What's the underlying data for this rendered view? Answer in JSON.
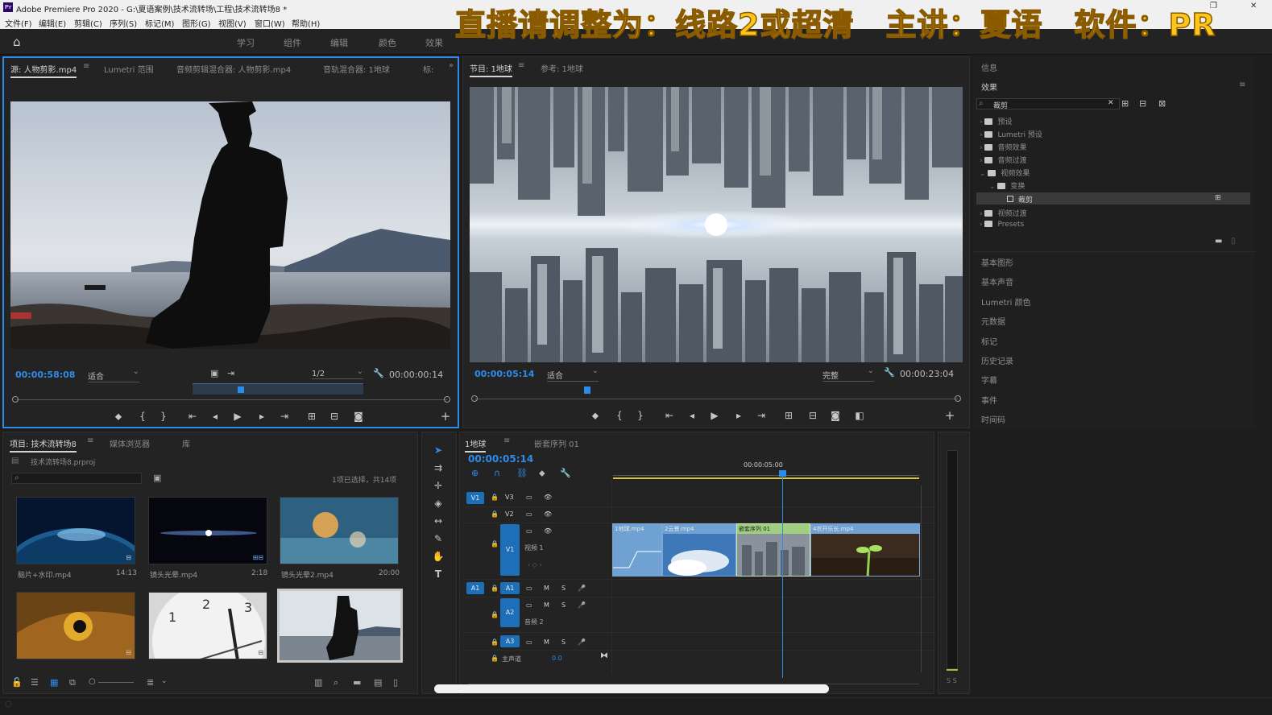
{
  "window": {
    "title": "Adobe Premiere Pro 2020 - G:\\夏语案例\\技术流转场\\工程\\技术流转场8 *",
    "app_icon": "Pr"
  },
  "menu": [
    "文件(F)",
    "编辑(E)",
    "剪辑(C)",
    "序列(S)",
    "标记(M)",
    "图形(G)",
    "视图(V)",
    "窗口(W)",
    "帮助(H)"
  ],
  "banner": "直播请调整为：线路2或超清　主讲：夏语　软件：PR",
  "workspaces": [
    "学习",
    "组件",
    "编辑",
    "颜色",
    "效果"
  ],
  "source_monitor": {
    "tabs": [
      "源: 人物剪影.mp4",
      "Lumetri 范围",
      "音频剪辑混合器: 人物剪影.mp4",
      "音轨混合器: 1地球",
      "标:"
    ],
    "timecode_left": "00:00:58:08",
    "fit": "适合",
    "resolution": "1/2",
    "timecode_right": "00:00:00:14"
  },
  "program_monitor": {
    "tabs": [
      "节目: 1地球",
      "参考: 1地球"
    ],
    "timecode_left": "00:00:05:14",
    "fit": "适合",
    "quality": "完整",
    "timecode_right": "00:00:23:04"
  },
  "effects_panel": {
    "info_tab": "信息",
    "title": "效果",
    "search_value": "裁剪",
    "tree": [
      {
        "label": "预设",
        "depth": 0
      },
      {
        "label": "Lumetri 预设",
        "depth": 0
      },
      {
        "label": "音频效果",
        "depth": 0
      },
      {
        "label": "音频过渡",
        "depth": 0
      },
      {
        "label": "视频效果",
        "depth": 0
      },
      {
        "label": "变换",
        "depth": 1
      },
      {
        "label": "裁剪",
        "depth": 2
      },
      {
        "label": "视频过渡",
        "depth": 0
      },
      {
        "label": "Presets",
        "depth": 0
      }
    ],
    "other_panels": [
      "基本图形",
      "基本声音",
      "Lumetri 颜色",
      "元数据",
      "标记",
      "历史记录",
      "字幕",
      "事件",
      "时间码"
    ]
  },
  "project_panel": {
    "tabs": [
      "项目: 技术流转场8",
      "媒体浏览器",
      "库"
    ],
    "project_file": "技术流转场8.prproj",
    "selection_info": "1项已选择，共14项",
    "items": [
      {
        "name": "脑片+水印.mp4",
        "duration": "14:13",
        "color": "#1a4d7a"
      },
      {
        "name": "镜头光晕.mp4",
        "duration": "2:18",
        "color": "#0a0d1c"
      },
      {
        "name": "镜头光晕2.mp4",
        "duration": "20:00",
        "color": "#3b6e8e"
      },
      {
        "name": "",
        "duration": "",
        "color": "#8a5a1a"
      },
      {
        "name": "",
        "duration": "",
        "color": "#e5e5e5"
      },
      {
        "name": "",
        "duration": "",
        "color": "#6a7080"
      }
    ]
  },
  "timeline": {
    "tabs": [
      "1地球",
      "嵌套序列 01"
    ],
    "timecode": "00:00:05:14",
    "ruler_label": "00:00:05:00",
    "video_tracks": [
      "V3",
      "V2",
      "V1"
    ],
    "v1_name": "视频 1",
    "audio_tracks": [
      "A1",
      "A2",
      "A3"
    ],
    "a2_name": "音频 2",
    "master": "主声道",
    "master_value": "0.0",
    "clips": [
      {
        "name": "1地球.mp4",
        "color": "#5f8fc0"
      },
      {
        "name": "2云景.mp4",
        "color": "#5f8fc0"
      },
      {
        "name": "嵌套序列 01",
        "color": "#9fcf7f"
      },
      {
        "name": "4农开乐长.mp4",
        "color": "#5f8fc0"
      }
    ]
  },
  "meter_label": "S S"
}
